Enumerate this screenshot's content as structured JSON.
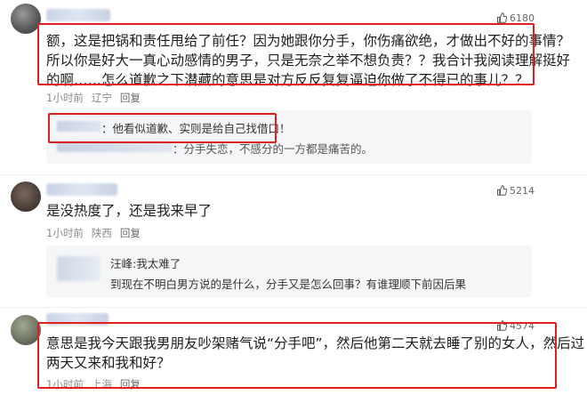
{
  "comments": [
    {
      "likes": "6180",
      "text_lines": [
        "额，这是把锅和责任甩给了前任？因为她跟你分手，你伤痛欲绝，才做出不好的事情？",
        "所以你是好大一真心动感情的男子，只是无奈之举不想负责？？我合计我阅读理解挺好",
        "的啊……怎么道歉之下潜藏的意思是对方反反复复逼迫你做了不得已的事儿？？"
      ],
      "time": "1小时前",
      "location": "辽宁",
      "reply_label": "回复",
      "replies": [
        {
          "text": "：他看似道歉、实则是给自己找借口！"
        },
        {
          "text": "：分手失恋，不感分的一方都是痛苦的。"
        }
      ]
    },
    {
      "likes": "5214",
      "text_lines": [
        "是没热度了，还是我来早了"
      ],
      "time": "1小时前",
      "location": "陕西",
      "reply_label": "回复",
      "replies": [
        {
          "text": "汪峰:我太难了"
        },
        {
          "text": "到现在不明白男方说的是什么，分手又是怎么回事？有谁理顺下前因后果"
        }
      ]
    },
    {
      "likes": "4574",
      "text_lines": [
        "意思是我今天跟我男朋友吵架赌气说“分手吧”，然后他第二天就去睡了别的女人，然后过",
        "两天又来和我和好？"
      ],
      "time": "1小时前",
      "location": "上海",
      "reply_label": "回复"
    }
  ],
  "colors": {
    "highlight": "#e02020",
    "reply_bg": "#f5f6f7",
    "meta": "#8a8a8a"
  },
  "icons": {
    "like": "thumbs-up-icon"
  }
}
